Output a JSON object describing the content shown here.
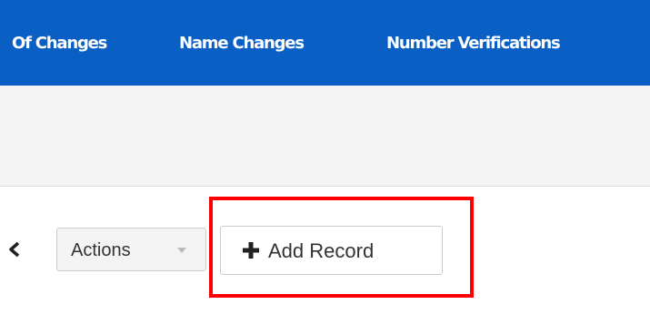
{
  "top_nav": {
    "items": [
      {
        "label": "Of Changes"
      },
      {
        "label": "Name Changes"
      },
      {
        "label": "Number Verifications"
      }
    ]
  },
  "toolbar": {
    "actions_label": "Actions",
    "add_record_label": "Add Record"
  },
  "colors": {
    "nav_background": "#0a5fc4",
    "subheader_background": "#f4f4f4",
    "highlight": "#ff0000"
  },
  "icons": {
    "back": "chevron-left-icon",
    "actions_caret": "caret-down-icon",
    "add": "plus-icon"
  }
}
